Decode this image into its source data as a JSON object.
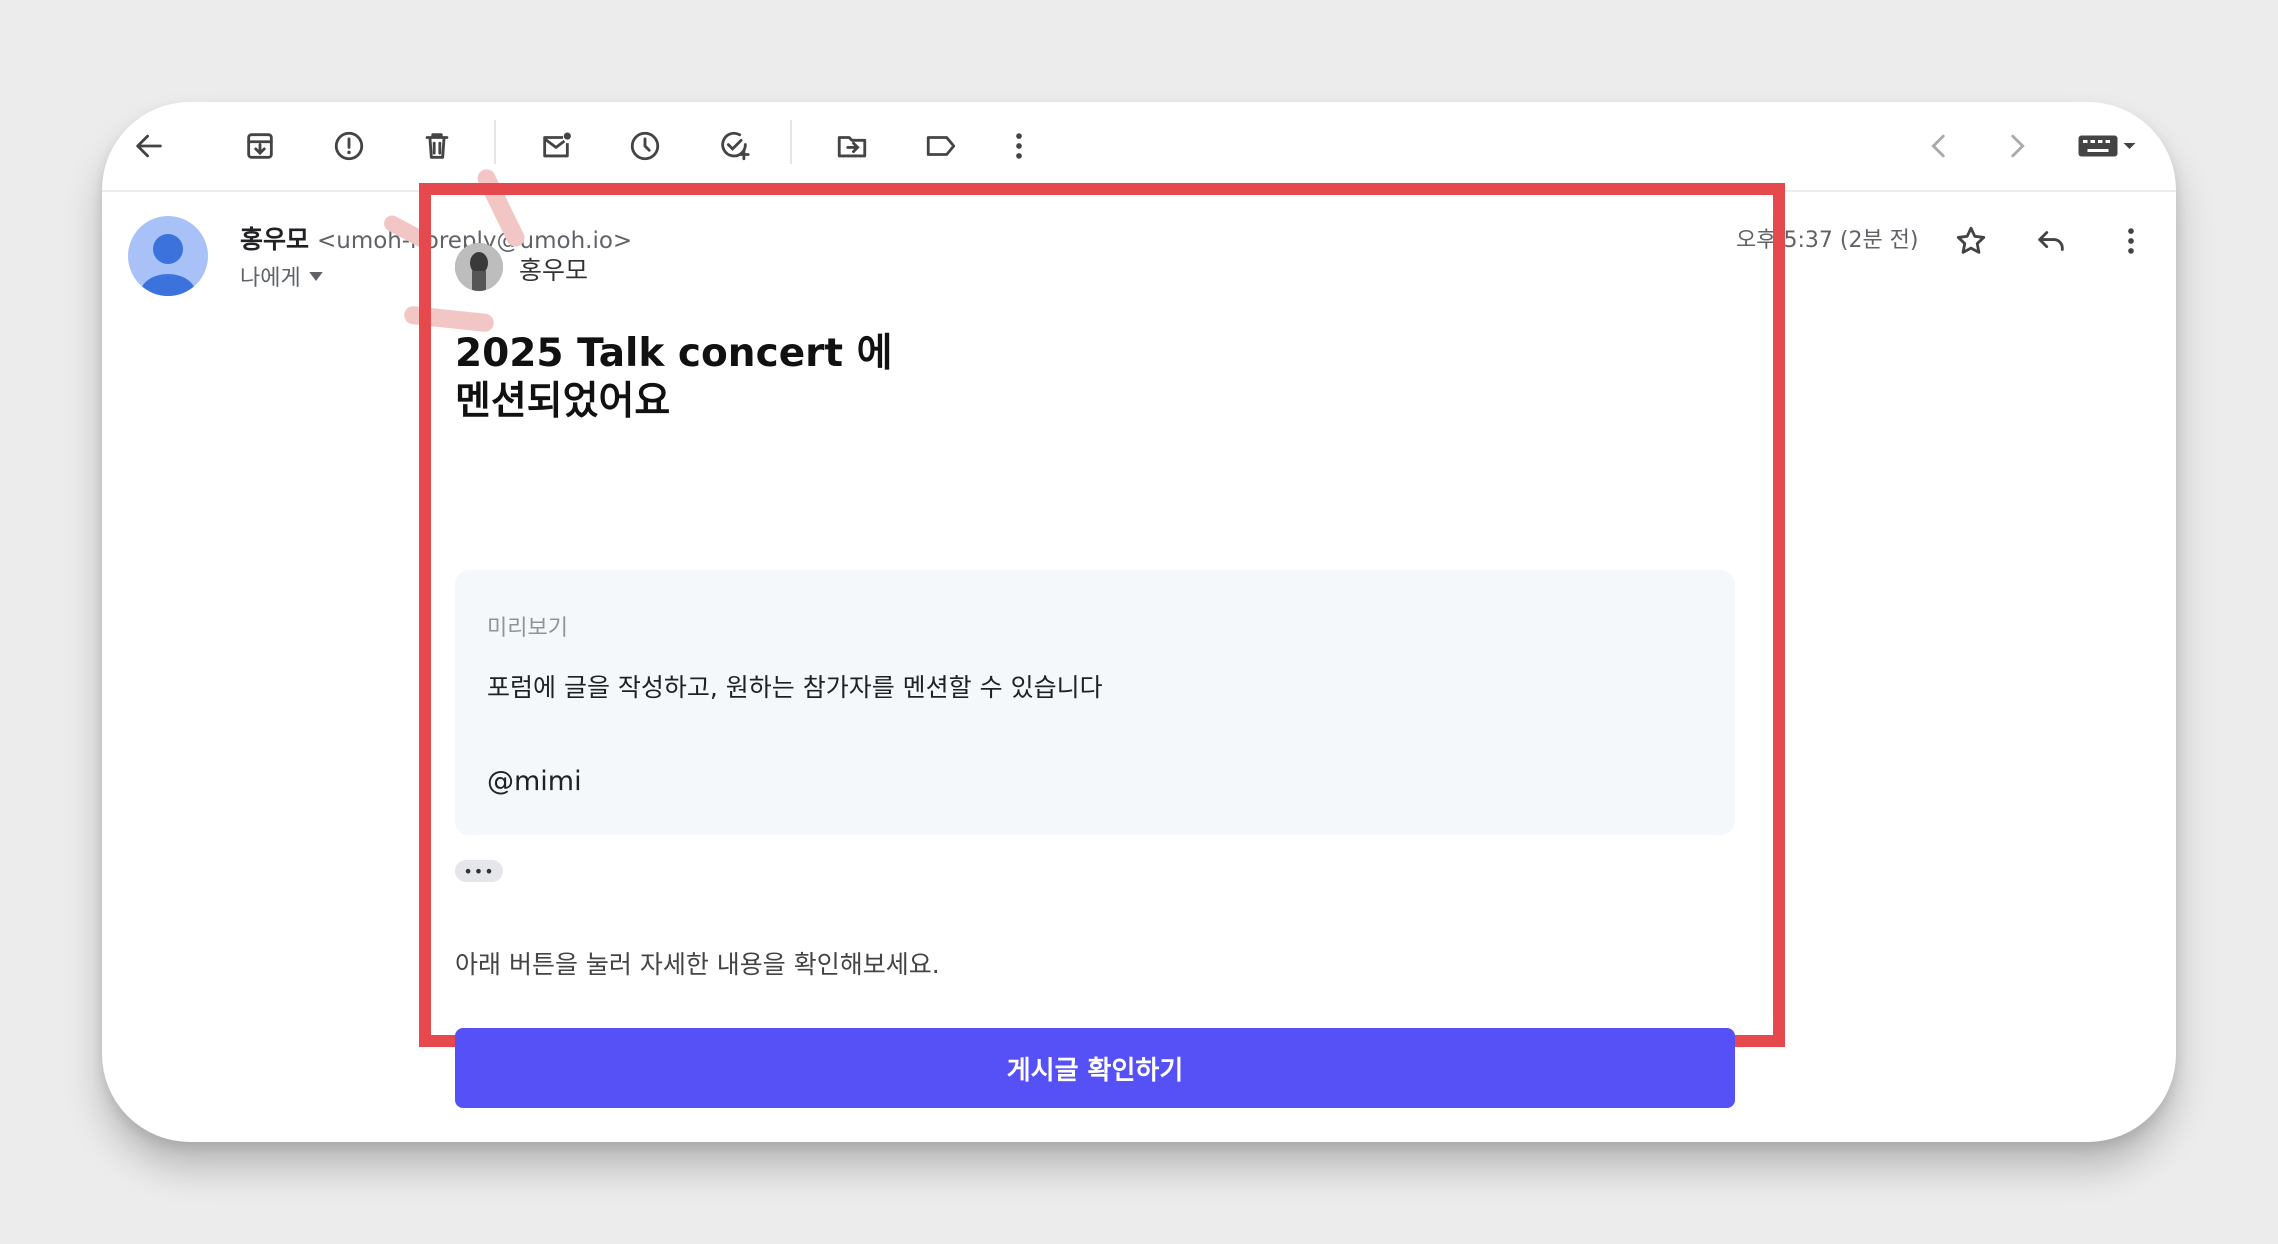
{
  "email": {
    "sender_name": "홍우모",
    "sender_email": "<umoh-noreply@umoh.io>",
    "recipients_label": "나에게",
    "timestamp": "오후 5:37 (2분 전)"
  },
  "card": {
    "author_name": "홍우모",
    "headline_line1": "2025 Talk concert 에",
    "headline_line2": "멘션되었어요",
    "preview_label": "미리보기",
    "preview_text": "포럼에 글을 작성하고, 원하는 참가자를 멘션할 수 있습니다",
    "preview_mention": "@mimi",
    "more_label": "•••",
    "instruction": "아래 버튼을 눌러 자세한 내용을 확인해보세요.",
    "cta_label": "게시글 확인하기"
  },
  "icons": {
    "back": "back-arrow-icon",
    "archive": "archive-icon",
    "report": "report-spam-icon",
    "delete": "trash-icon",
    "unread": "mark-unread-icon",
    "snooze": "snooze-clock-icon",
    "add_task": "add-task-icon",
    "move": "move-to-icon",
    "label": "label-icon",
    "more": "more-vertical-icon",
    "prev": "chevron-left-icon",
    "next": "chevron-right-icon",
    "keyboard": "keyboard-icon",
    "star": "star-icon",
    "reply": "reply-icon"
  },
  "colors": {
    "highlight": "#e5484d",
    "cta": "#5551f7",
    "avatar": "#a8c1f7"
  }
}
